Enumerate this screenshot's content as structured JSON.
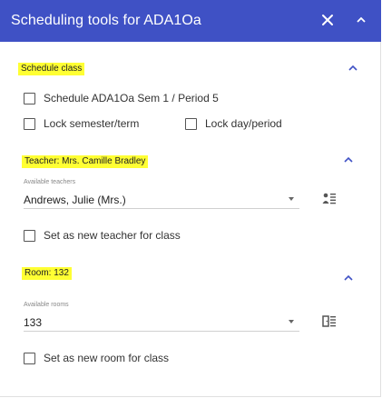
{
  "header": {
    "title": "Scheduling tools for ADA1Oa"
  },
  "schedule": {
    "title": "Schedule class",
    "schedule_label": "Schedule ADA1Oa  Sem 1 / Period 5",
    "lock_term_label": "Lock semester/term",
    "lock_day_label": "Lock day/period"
  },
  "teacher": {
    "title": "Teacher: Mrs. Camille Bradley",
    "field_label": "Available teachers",
    "selected": "Andrews, Julie (Mrs.)",
    "set_new_label": "Set as new teacher for class"
  },
  "room": {
    "title": "Room: 132",
    "field_label": "Available rooms",
    "selected": "133",
    "set_new_label": "Set as new room for class"
  },
  "colors": {
    "header_bg": "#3f51c5",
    "highlight": "#ffff33"
  },
  "icons": {
    "close": "close-icon",
    "collapse": "chevron-up-icon",
    "teacher_list": "teacher-list-icon",
    "room_list": "room-list-icon"
  }
}
